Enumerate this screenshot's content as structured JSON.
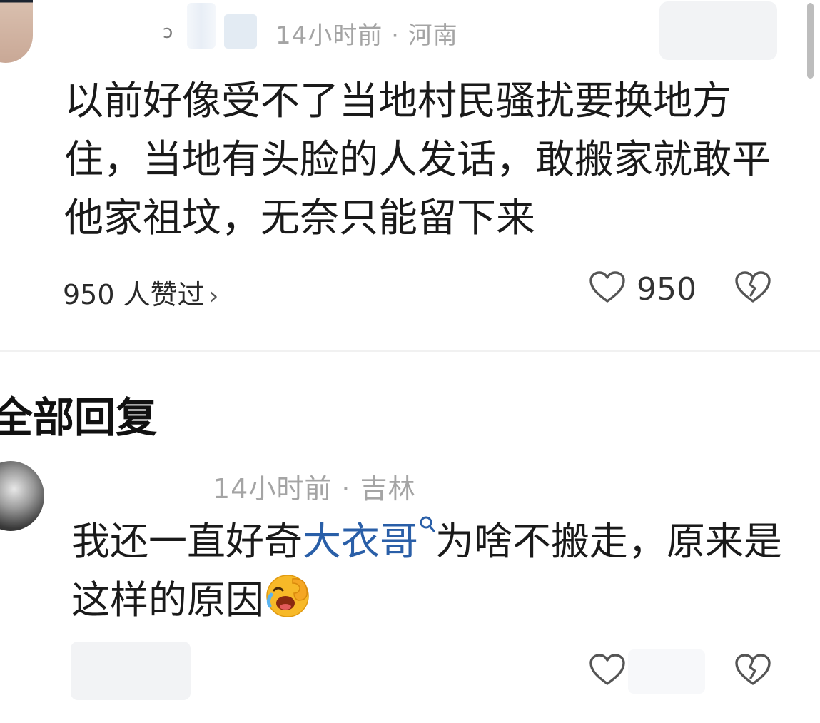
{
  "comment": {
    "name_fragment": "ɔ",
    "meta": "14小时前 · 河南",
    "text": "以前好像受不了当地村民骚扰要换地方住，当地有头脸的人发话，敢搬家就敢平他家祖坟，无奈只能留下来",
    "likers": "950 人赞过",
    "likers_chevron": "›",
    "like_count": "950"
  },
  "section": {
    "title": "全部回复"
  },
  "reply": {
    "meta": "14小时前 · 吉林",
    "text_before": "我还一直好奇",
    "mention": "大衣哥",
    "text_after": "为啥不搬走，原来是这样的原因"
  },
  "icons": {
    "like": "heart-outline-icon",
    "dislike": "broken-heart-icon",
    "search": "search-icon",
    "emoji": "laugh-cry-emoji-icon"
  },
  "colors": {
    "mention": "#2a5fa8",
    "meta": "#a4a4a4",
    "text": "#1a1a1a"
  }
}
